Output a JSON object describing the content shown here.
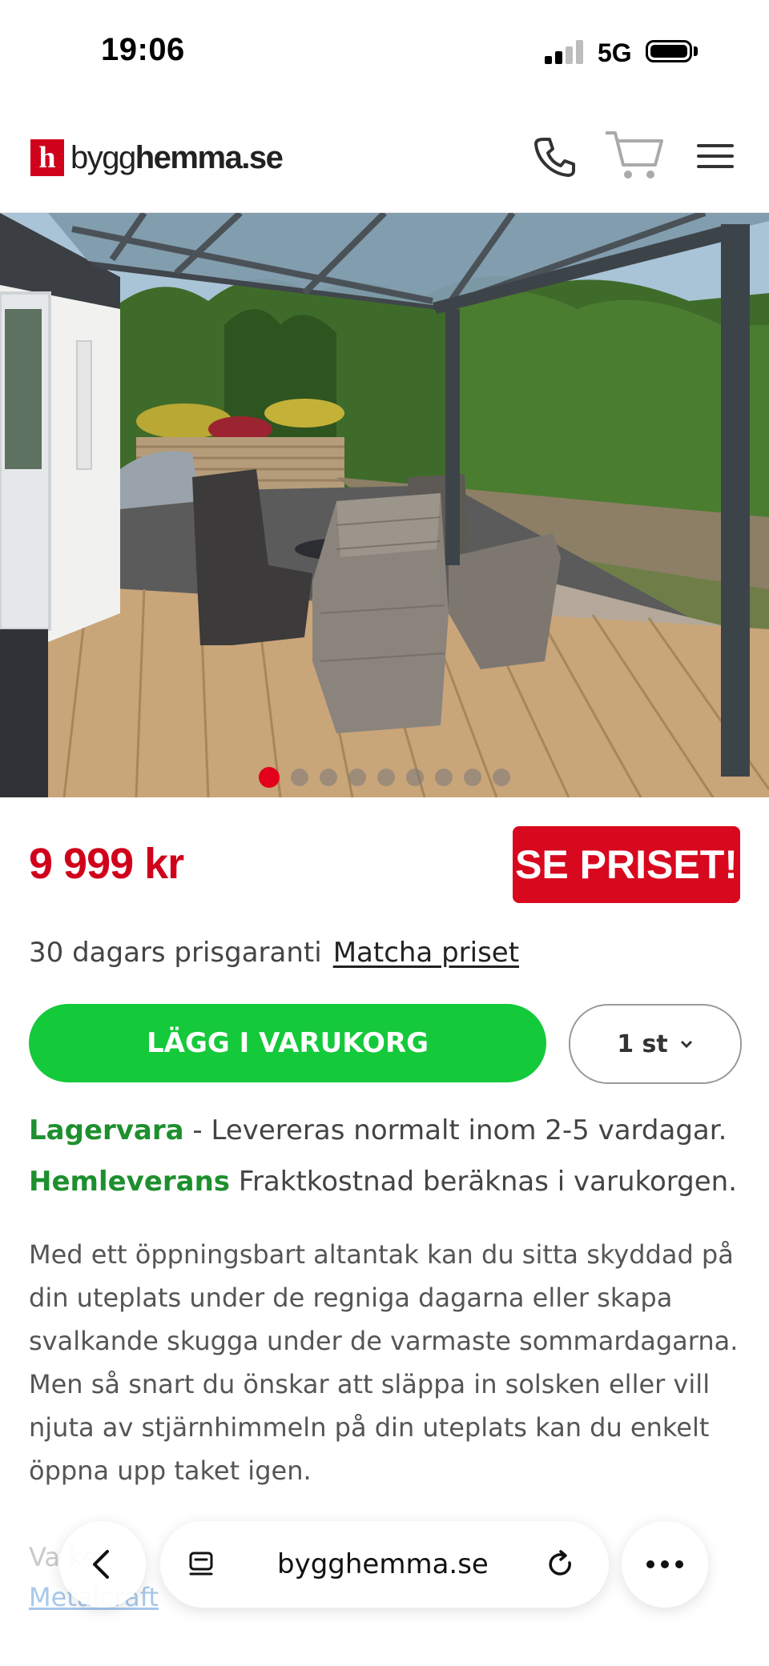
{
  "status_bar": {
    "time": "19:06",
    "network": "5G"
  },
  "header": {
    "logo_letter": "h",
    "logo_text_light": "bygg",
    "logo_text_bold": "hemma",
    "logo_text_tld": ".se"
  },
  "icons": {
    "phone": "phone-icon",
    "cart": "cart-icon",
    "menu": "hamburger-menu-icon",
    "back": "chevron-left-icon",
    "more": "more-dots-icon",
    "tabs": "tabs-icon",
    "reload": "reload-icon",
    "qty_dropdown": "chevron-down-icon"
  },
  "gallery": {
    "active_index": 1,
    "total": 9
  },
  "product": {
    "price": "9 999 kr",
    "see_price_button": "SE PRISET!",
    "guarantee_text": "30 dagars prisgaranti",
    "match_price_link": "Matcha priset",
    "add_to_cart": "LÄGG I VARUKORG",
    "quantity": "1 st",
    "stock_label": "Lagervara",
    "stock_text": " - Levereras normalt inom 2-5 vardagar.",
    "delivery_label": "Hemleverans",
    "delivery_text": " Fraktkostnad beräknas i varukorgen.",
    "description_lines": [
      "Med ett öppningsbart altantak kan du sitta skyddad på",
      "din uteplats under de regniga dagarna eller skapa",
      "svalkande skugga under de varmaste sommardagarna.",
      "Men så snart du önskar att släppa in solsken eller vill",
      "njuta av stjärnhimmeln på din uteplats kan du enkelt",
      "öppna upp taket igen."
    ],
    "partial_text": "Va         ke",
    "partial_link": "Metalcraft"
  },
  "browser": {
    "url": "bygghemma.se"
  },
  "colors": {
    "brand_red": "#d0021b",
    "cta_green": "#14c93a",
    "stock_green": "#1e8f2e"
  }
}
